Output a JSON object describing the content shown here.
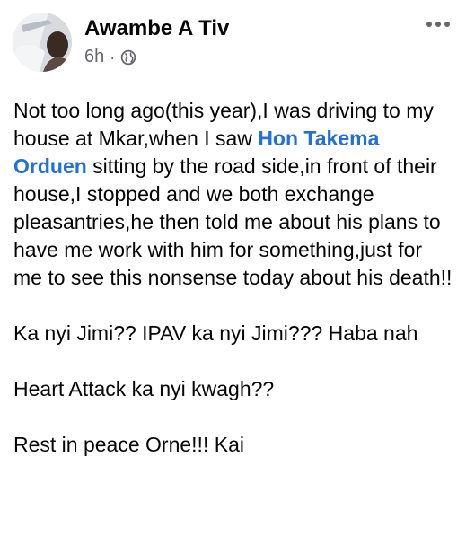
{
  "post": {
    "author": "Awambe A Tiv",
    "timestamp": "6h",
    "separator": "·",
    "audience_icon": "globe-icon",
    "more_icon": "more-options-icon",
    "mention_color": "#216fdb",
    "body": {
      "p1_before": "Not too long ago(this year),I was driving to my house at Mkar,when I saw ",
      "p1_mention": "Hon Takema Orduen",
      "p1_after": " sitting by the road side,in front of their house,I stopped and we both exchange pleasantries,he then told me about his plans to have me work with him for something,just for me to see this nonsense today about his death!!",
      "p2": "Ka nyi Jimi?? IPAV ka nyi Jimi??? Haba nah",
      "p3": "Heart Attack ka nyi kwagh??",
      "p4": "Rest in peace Orne!!! Kai"
    }
  }
}
